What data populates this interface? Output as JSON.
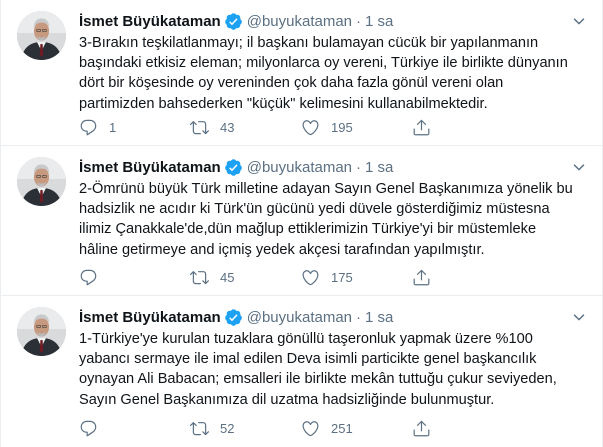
{
  "tweets": [
    {
      "author": {
        "name": "İsmet Büyükataman",
        "handle": "@buyukataman",
        "verified": true
      },
      "separator": "·",
      "time": "1 sa",
      "lines": [
        "3-Bırakın teşkilatlanmayı; il başkanı bulamayan cücük bir yapılanmanın",
        "başındaki etkisiz eleman; milyonlarca oy vereni, Türkiye ile birlikte dünyanın",
        "dört bir köşesinde oy vereninden çok daha fazla gönül vereni olan",
        "partimizden bahsederken \"küçük\" kelimesini kullanabilmektedir."
      ],
      "replies": "1",
      "retweets": "43",
      "likes": "195"
    },
    {
      "author": {
        "name": "İsmet Büyükataman",
        "handle": "@buyukataman",
        "verified": true
      },
      "separator": "·",
      "time": "1 sa",
      "lines": [
        "2-Ömrünü büyük Türk milletine adayan Sayın Genel Başkanımıza yönelik bu",
        "hadsizlik ne acıdır ki Türk'ün gücünü yedi düvele gösterdiğimiz müstesna",
        "ilimiz Çanakkale'de,dün mağlup ettiklerimizin Türkiye'yi bir müstemleke",
        "hâline getirmeye and içmiş yedek akçesi tarafından yapılmıştır."
      ],
      "replies": "",
      "retweets": "45",
      "likes": "175"
    },
    {
      "author": {
        "name": "İsmet Büyükataman",
        "handle": "@buyukataman",
        "verified": true
      },
      "separator": "·",
      "time": "1 sa",
      "lines": [
        "1-Türkiye'ye kurulan tuzaklara gönüllü taşeronluk yapmak üzere %100",
        "yabancı sermaye ile imal edilen Deva isimli particikte genel başkancılık",
        "oynayan Ali Babacan; emsalleri ile birlikte mekân tuttuğu çukur seviyeden,",
        "Sayın Genel Başkanımıza dil uzatma hadsizliğinde bulunmuştur."
      ],
      "replies": "",
      "retweets": "52",
      "likes": "251"
    }
  ],
  "icons": {
    "verified": "verified-badge-icon",
    "more": "chevron-down-icon",
    "reply": "reply-icon",
    "retweet": "retweet-icon",
    "like": "heart-icon",
    "share": "share-icon"
  },
  "colors": {
    "text": "#0f1419",
    "secondary": "#5b7083",
    "verified": "#1da1f2",
    "divider": "#ebeef0"
  }
}
